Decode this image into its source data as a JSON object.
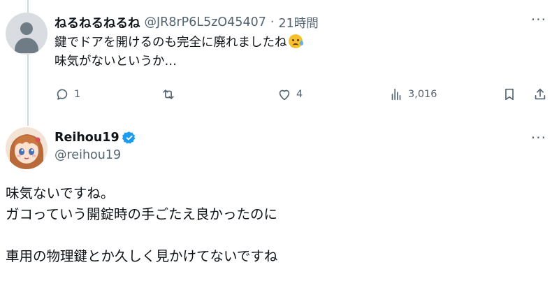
{
  "tweet": {
    "author_name": "ねるねるねるね",
    "author_handle": "@JR8rP6L5zO45407",
    "separator": "·",
    "time": "21時間",
    "text_line1": "鍵でドアを開けるのも完全に廃れましたね",
    "text_line2": "味気がないというか…",
    "emoji": "sad-tear-emoji",
    "actions": {
      "reply_count": "1",
      "repost_count": "",
      "like_count": "4",
      "view_count": "3,016"
    }
  },
  "reply": {
    "author_name": "Reihou19",
    "author_handle": "@reihou19",
    "verified": true,
    "lines": [
      "味気ないですね。",
      "ガコっていう開錠時の手ごたえ良かったのに",
      "",
      "車用の物理鍵とか久しく見かけてないですね"
    ]
  },
  "colors": {
    "text": "#0f1419",
    "muted": "#536471",
    "verified_blue": "#1d9bf0",
    "thread_line": "#cfd9de"
  },
  "icons": {
    "more": "more-dots-icon",
    "reply": "reply-bubble-icon",
    "repost": "repost-icon",
    "like": "heart-icon",
    "views": "views-bar-icon",
    "bookmark": "bookmark-icon",
    "share": "share-icon",
    "verified": "verified-badge-icon"
  }
}
